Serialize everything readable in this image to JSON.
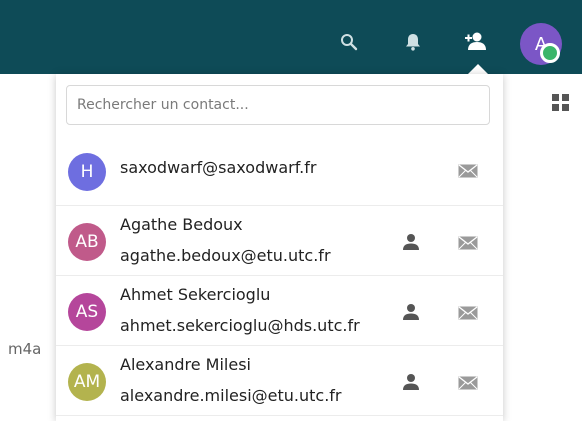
{
  "colors": {
    "topbar": "#0e4b57",
    "user_avatar": "#7b56c6",
    "status_online": "#3bb56a"
  },
  "topbar": {
    "icons": [
      "search-icon",
      "notifications-bell-icon",
      "contacts-icon"
    ],
    "user_avatar_initial": "A"
  },
  "background": {
    "partial_text": "m4a",
    "icons": [
      "grid-view-icon"
    ]
  },
  "contacts_menu": {
    "search_placeholder": "Rechercher un contact...",
    "contacts": [
      {
        "initials": "H",
        "name": "",
        "email": "saxodwarf@saxodwarf.fr",
        "color": "#6e6ee0",
        "icons": [
          "mail-icon"
        ]
      },
      {
        "initials": "AB",
        "name": "Agathe Bedoux",
        "email": "agathe.bedoux@etu.utc.fr",
        "color": "#c05a8a",
        "icons": [
          "profile-icon",
          "mail-icon"
        ]
      },
      {
        "initials": "AS",
        "name": "Ahmet Sekercioglu",
        "email": "ahmet.sekercioglu@hds.utc.fr",
        "color": "#b5469b",
        "icons": [
          "profile-icon",
          "mail-icon"
        ]
      },
      {
        "initials": "AM",
        "name": "Alexandre Milesi",
        "email": "alexandre.milesi@etu.utc.fr",
        "color": "#b3b34e",
        "icons": [
          "profile-icon",
          "mail-icon"
        ]
      }
    ]
  }
}
